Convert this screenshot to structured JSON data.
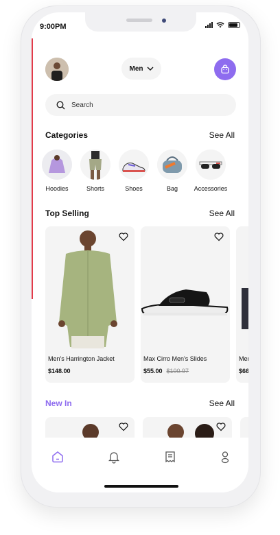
{
  "status_bar": {
    "time": "9:00PM"
  },
  "header": {
    "gender_selector": "Men"
  },
  "search": {
    "placeholder": "Search"
  },
  "categories": {
    "title": "Categories",
    "see_all": "See All",
    "items": [
      {
        "label": "Hoodies",
        "icon": "hoodie-image"
      },
      {
        "label": "Shorts",
        "icon": "shorts-image"
      },
      {
        "label": "Shoes",
        "icon": "shoes-image"
      },
      {
        "label": "Bag",
        "icon": "bag-image"
      },
      {
        "label": "Accessories",
        "icon": "sunglasses-image"
      }
    ]
  },
  "top_selling": {
    "title": "Top Selling",
    "see_all": "See All",
    "products": [
      {
        "name": "Men's Harrington Jacket",
        "price": "$148.00"
      },
      {
        "name": "Max Cirro Men's Slides",
        "price": "$55.00",
        "old_price": "$100.97"
      },
      {
        "name": "Men",
        "price": "$66"
      }
    ]
  },
  "new_in": {
    "title": "New In",
    "see_all": "See All"
  },
  "tab_bar": {
    "items": [
      "home-icon",
      "bell-icon",
      "receipt-icon",
      "profile-icon"
    ]
  },
  "colors": {
    "accent": "#8e6cef",
    "card_bg": "#f4f4f4",
    "text": "#111111"
  }
}
